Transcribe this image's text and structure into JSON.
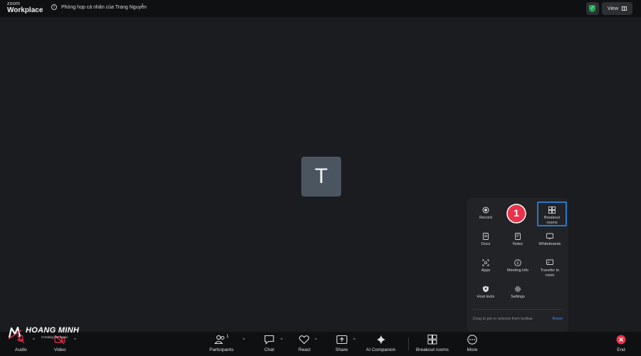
{
  "topbar": {
    "logo_zoom": "zoom",
    "logo_workplace": "Workplace",
    "meeting_title": "Phòng họp cá nhân của Trang Nguyễn",
    "view_label": "View"
  },
  "video": {
    "avatar_initial": "T"
  },
  "more_menu": {
    "items": [
      {
        "label": "Record",
        "icon": "record-icon"
      },
      {
        "label": "Breakout rooms",
        "icon": "breakout-rooms-icon"
      },
      {
        "label": "Docs",
        "icon": "docs-icon"
      },
      {
        "label": "Notes",
        "icon": "notes-icon"
      },
      {
        "label": "Whiteboards",
        "icon": "whiteboard-icon"
      },
      {
        "label": "Apps",
        "icon": "apps-icon"
      },
      {
        "label": "Meeting info",
        "icon": "info-icon"
      },
      {
        "label": "Transfer to room",
        "icon": "transfer-icon"
      },
      {
        "label": "Host tools",
        "icon": "shield-icon"
      },
      {
        "label": "Settings",
        "icon": "gear-icon"
      }
    ],
    "step_number": "1",
    "hint": "Drag to pin or remove from toolbar",
    "reset_label": "Reset"
  },
  "toolbar": {
    "audio": "Audio",
    "video": "Video",
    "participants": "Participants",
    "participants_count": "1",
    "chat": "Chat",
    "react": "React",
    "share": "Share",
    "ai_companion": "AI Companion",
    "breakout_rooms": "Breakout rooms",
    "more": "More",
    "end": "End"
  },
  "watermark": {
    "brand": "HOANG MINH",
    "tagline": "Creating the future"
  },
  "colors": {
    "background": "#1a1c1f",
    "bar": "#0f1012",
    "panel": "#212327",
    "highlight": "#2b78c5",
    "badge": "#e8334a",
    "end": "#e8334a",
    "secure": "#21a652"
  }
}
